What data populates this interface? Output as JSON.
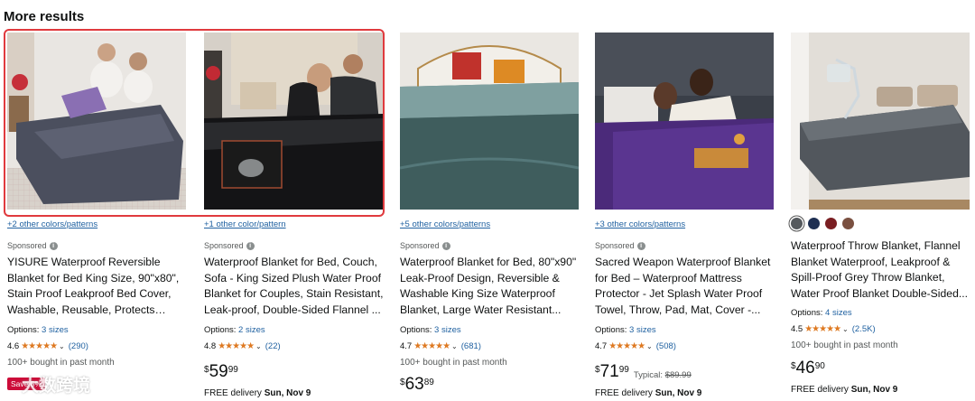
{
  "header": {
    "title": "More results"
  },
  "products": [
    {
      "colors_text": "+2 other colors/patterns",
      "sponsored": "Sponsored",
      "title": "YISURE Waterproof Reversible Blanket for Bed King Size, 90\"x80\", Stain Proof Leakproof Bed Cover, Washable, Reusable, Protects Beds...",
      "options_label": "Options:",
      "options_value": "3 sizes",
      "rating": "4.6",
      "reviews": "(290)",
      "bought": "100+ bought in past month",
      "price_symbol": "$",
      "price_whole": "",
      "price_fraction": "",
      "delivery_prefix": "",
      "delivery_date": ""
    },
    {
      "colors_text": "+1 other color/pattern",
      "sponsored": "Sponsored",
      "title": "Waterproof Blanket for Bed, Couch, Sofa - King Sized Plush Water Proof Blanket for Couples, Stain Resistant, Leak-proof, Double-Sided Flannel ...",
      "options_label": "Options:",
      "options_value": "2 sizes",
      "rating": "4.8",
      "reviews": "(22)",
      "bought": "",
      "price_symbol": "$",
      "price_whole": "59",
      "price_fraction": "99",
      "delivery_prefix": "FREE delivery",
      "delivery_date": "Sun, Nov 9"
    },
    {
      "colors_text": "+5 other colors/patterns",
      "sponsored": "Sponsored",
      "title": "Waterproof Blanket for Bed, 80\"x90\" Leak-Proof Design, Reversible & Washable King Size Waterproof Blanket, Large Water Resistant...",
      "options_label": "Options:",
      "options_value": "3 sizes",
      "rating": "4.7",
      "reviews": "(681)",
      "bought": "100+ bought in past month",
      "price_symbol": "$",
      "price_whole": "63",
      "price_fraction": "89",
      "delivery_prefix": "",
      "delivery_date": ""
    },
    {
      "colors_text": "+3 other colors/patterns",
      "sponsored": "Sponsored",
      "title": "Sacred Weapon Waterproof Blanket for Bed – Waterproof Mattress Protector - Jet Splash Water Proof Towel, Throw, Pad, Mat, Cover -...",
      "options_label": "Options:",
      "options_value": "3 sizes",
      "rating": "4.7",
      "reviews": "(508)",
      "bought": "",
      "price_symbol": "$",
      "price_whole": "71",
      "price_fraction": "99",
      "typical_label": "Typical:",
      "typical_price": "$89.99",
      "delivery_prefix": "FREE delivery",
      "delivery_date": "Sun, Nov 9"
    },
    {
      "colors_text": "",
      "swatches": [
        "#565a5e",
        "#1e2f52",
        "#7a1e22",
        "#7a5040"
      ],
      "sponsored": "",
      "title": "Waterproof Throw Blanket, Flannel Blanket Waterproof, Leakproof & Spill-Proof Grey Throw Blanket, Water Proof Blanket Double-Sided...",
      "options_label": "Options:",
      "options_value": "4 sizes",
      "rating": "4.5",
      "reviews": "(2.5K)",
      "bought": "100+ bought in past month",
      "price_symbol": "$",
      "price_whole": "46",
      "price_fraction": "90",
      "delivery_prefix": "FREE delivery",
      "delivery_date": "Sun, Nov 9"
    }
  ],
  "badge": {
    "save": "Save 5%"
  },
  "watermark": {
    "text": "大数跨境"
  },
  "colors": {
    "link": "#2162a1",
    "star": "#de7921",
    "highlight": "#e03a3e",
    "badge": "#cc0c39"
  }
}
